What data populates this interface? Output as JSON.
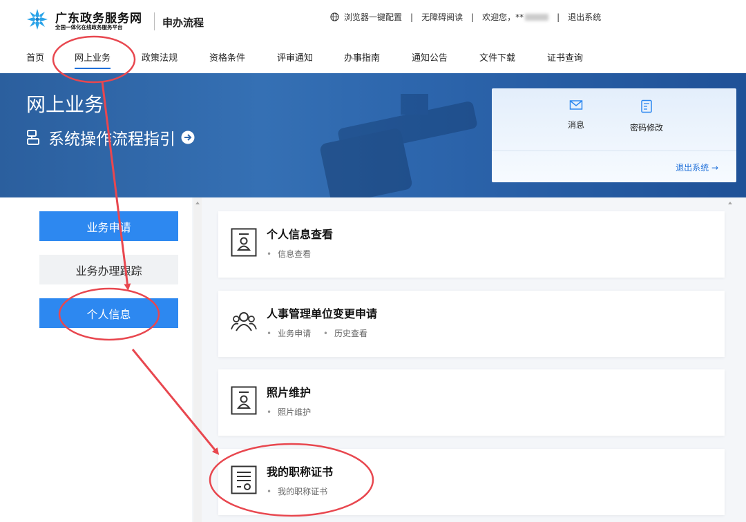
{
  "header": {
    "brand_main": "广东政务服务网",
    "brand_sub": "全国一体化在线政务服务平台",
    "section": "申办流程",
    "browser_config": "浏览器一键配置",
    "accessibility": "无障碍阅读",
    "welcome": "欢迎您，**",
    "logout": "退出系统",
    "separator": "|"
  },
  "nav": {
    "items": [
      {
        "label": "首页"
      },
      {
        "label": "网上业务"
      },
      {
        "label": "政策法规"
      },
      {
        "label": "资格条件"
      },
      {
        "label": "评审通知"
      },
      {
        "label": "办事指南"
      },
      {
        "label": "通知公告"
      },
      {
        "label": "文件下载"
      },
      {
        "label": "证书查询"
      }
    ],
    "active_index": 1
  },
  "banner": {
    "title": "网上业务",
    "guide": "系统操作流程指引",
    "panel": {
      "message_label": "消息",
      "password_label": "密码修改",
      "logout_label": "退出系统 →"
    }
  },
  "sidebar": {
    "items": [
      {
        "label": "业务申请"
      },
      {
        "label": "业务办理跟踪"
      },
      {
        "label": "个人信息"
      }
    ]
  },
  "cards": [
    {
      "title": "个人信息查看",
      "icon": "id-card-icon",
      "links": [
        "信息查看"
      ]
    },
    {
      "title": "人事管理单位变更申请",
      "icon": "users-icon",
      "links": [
        "业务申请",
        "历史查看"
      ]
    },
    {
      "title": "照片维护",
      "icon": "id-card-icon",
      "links": [
        "照片维护"
      ]
    },
    {
      "title": "我的职称证书",
      "icon": "certificate-icon",
      "links": [
        "我的职称证书"
      ]
    }
  ],
  "colors": {
    "primary": "#2d88f0",
    "annotation": "#e8474f",
    "banner": "#2d66ad"
  }
}
